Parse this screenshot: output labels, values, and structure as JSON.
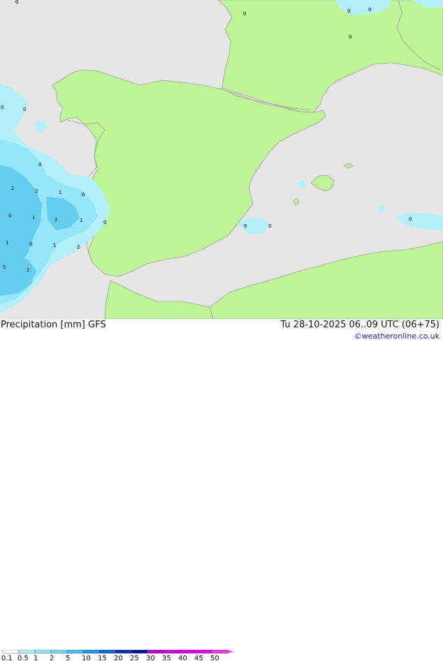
{
  "header": {
    "title": "Precipitation [mm] GFS",
    "datetime": "Tu 28-10-2025 06..09 UTC (06+75)",
    "credit": "©weatheronline.co.uk"
  },
  "legend": {
    "labels": [
      "0.1",
      "0.5",
      "1",
      "2",
      "5",
      "10",
      "15",
      "20",
      "25",
      "30",
      "35",
      "40",
      "45",
      "50"
    ],
    "colors": [
      "#ffffff",
      "#b4f0fa",
      "#96e6fa",
      "#78d6f5",
      "#4bbef0",
      "#2896e6",
      "#1464d2",
      "#0a32b4",
      "#05148c",
      "#b400d2",
      "#c800dc",
      "#dc00e6",
      "#f000f0",
      "#f03cdc"
    ]
  },
  "map": {
    "sea_color": "#e6e6e6",
    "land_color": "#bef596",
    "border_color": "#a0a0a0",
    "precip_colors": {
      "light": "#b4f0fa",
      "mid": "#96e6fa",
      "high": "#64cdf0"
    },
    "value_labels": [
      "0",
      "0",
      "0",
      "0",
      "0",
      "0",
      "0",
      "0",
      "0",
      "0",
      "0",
      "0",
      "0",
      "2",
      "2",
      "1",
      "0",
      "1",
      "2",
      "1",
      "1",
      "0",
      "1",
      "2",
      "0",
      "0",
      "5",
      "2"
    ]
  }
}
